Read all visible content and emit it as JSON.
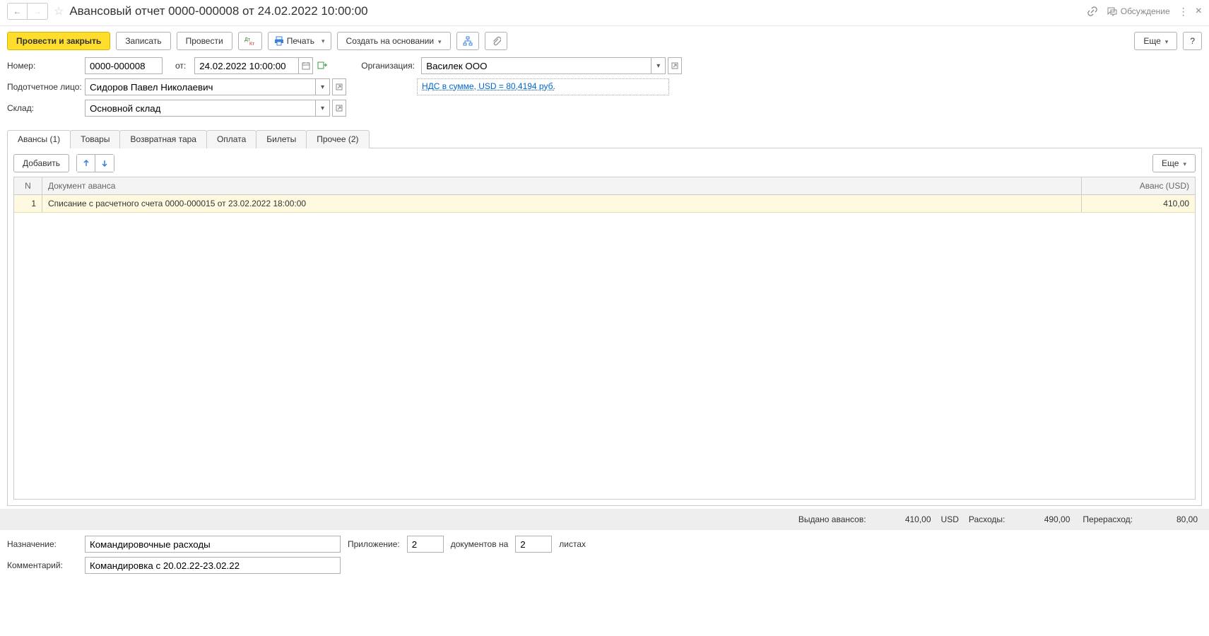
{
  "header": {
    "title": "Авансовый отчет 0000-000008 от 24.02.2022 10:00:00",
    "discussion": "Обсуждение"
  },
  "toolbar": {
    "post_close": "Провести и закрыть",
    "save": "Записать",
    "post": "Провести",
    "print": "Печать",
    "create_based": "Создать на основании",
    "more": "Еще",
    "help": "?"
  },
  "form": {
    "number_label": "Номер:",
    "number": "0000-000008",
    "from_label": "от:",
    "date": "24.02.2022 10:00:00",
    "org_label": "Организация:",
    "org": "Василек ООО",
    "person_label": "Подотчетное лицо:",
    "person": "Сидоров Павел Николаевич",
    "vat_link": "НДС в сумме, USD = 80,4194 руб.",
    "warehouse_label": "Склад:",
    "warehouse": "Основной склад"
  },
  "tabs": {
    "advances": "Авансы (1)",
    "goods": "Товары",
    "tare": "Возвратная тара",
    "payment": "Оплата",
    "tickets": "Билеты",
    "other": "Прочее (2)"
  },
  "subtoolbar": {
    "add": "Добавить",
    "more": "Еще"
  },
  "grid": {
    "col_n": "N",
    "col_doc": "Документ аванса",
    "col_amt": "Аванс (USD)",
    "rows": [
      {
        "n": "1",
        "doc": "Списание с расчетного счета 0000-000015 от 23.02.2022 18:00:00",
        "amt": "410,00"
      }
    ]
  },
  "summary": {
    "issued_label": "Выдано авансов:",
    "issued": "410,00",
    "currency": "USD",
    "expenses_label": "Расходы:",
    "expenses": "490,00",
    "over_label": "Перерасход:",
    "over": "80,00"
  },
  "footer": {
    "purpose_label": "Назначение:",
    "purpose": "Командировочные расходы",
    "attach_label": "Приложение:",
    "attach_count": "2",
    "docs_text": "документов на",
    "sheets_count": "2",
    "sheets_text": "листах",
    "comment_label": "Комментарий:",
    "comment": "Командировка с 20.02.22-23.02.22"
  }
}
